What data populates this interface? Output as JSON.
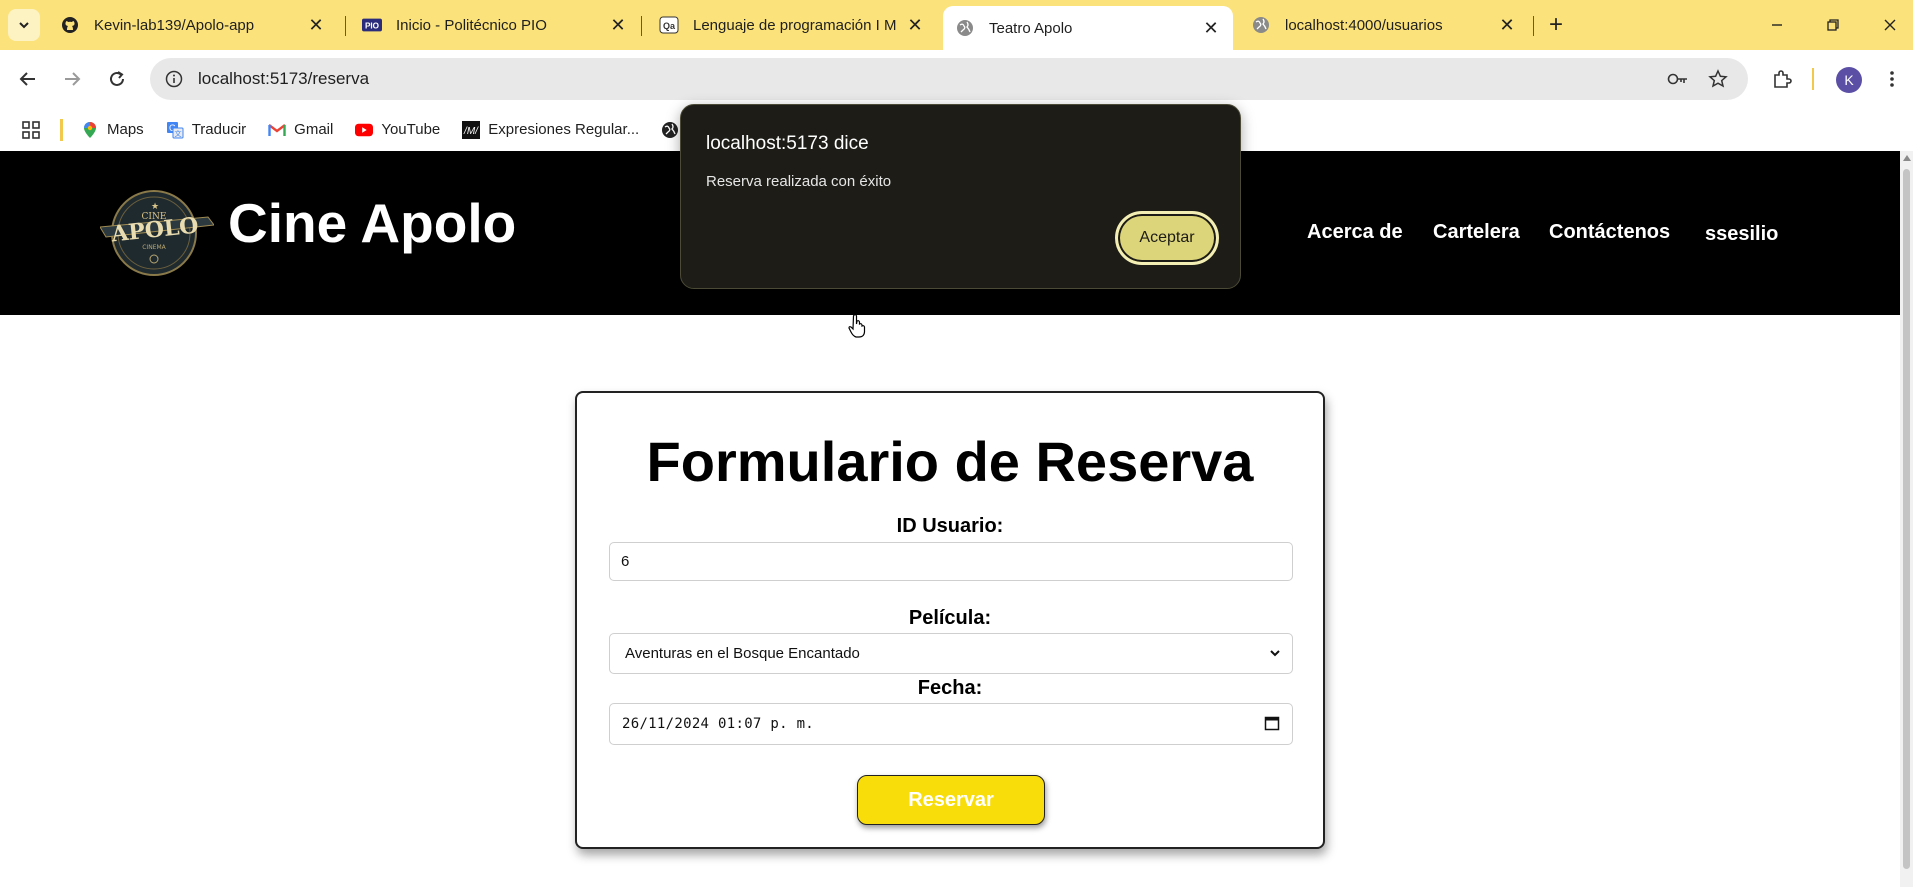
{
  "browser": {
    "tabs": [
      {
        "title": "Kevin-lab139/Apolo-app",
        "icon": "github-icon",
        "active": false
      },
      {
        "title": "Inicio - Politécnico PIO",
        "icon": "pio-icon",
        "active": false
      },
      {
        "title": "Lenguaje de programación I M-",
        "icon": "qa-icon",
        "active": false
      },
      {
        "title": "Teatro Apolo",
        "icon": "globe-icon",
        "active": true
      },
      {
        "title": "localhost:4000/usuarios",
        "icon": "globe-icon",
        "active": false
      }
    ],
    "url": "localhost:5173/reserva",
    "profile_initial": "K",
    "bookmarks": [
      {
        "label": "Maps",
        "icon": "maps-icon"
      },
      {
        "label": "Traducir",
        "icon": "translate-icon"
      },
      {
        "label": "Gmail",
        "icon": "gmail-icon"
      },
      {
        "label": "YouTube",
        "icon": "youtube-icon"
      },
      {
        "label": "Expresiones Regular...",
        "icon": "regex-icon"
      }
    ]
  },
  "site": {
    "brand": "Cine Apolo",
    "nav": [
      "Acerca de",
      "Cartelera",
      "Contáctenos",
      "ssesilio"
    ]
  },
  "form": {
    "title": "Formulario de Reserva",
    "user_id_label": "ID Usuario:",
    "user_id_value": "6",
    "movie_label": "Película:",
    "movie_value": "Aventuras en el Bosque Encantado",
    "date_label": "Fecha:",
    "date_value": "26/11/2024 01:07 p. m.",
    "submit_label": "Reservar"
  },
  "dialog": {
    "title": "localhost:5173 dice",
    "message": "Reserva realizada con éxito",
    "ok_label": "Aceptar"
  },
  "colors": {
    "tabstrip": "#fbe27a",
    "header": "#000000",
    "submit": "#f8dd0b",
    "dialog_bg": "#1d1c16",
    "dialog_button": "#ddd57a"
  }
}
